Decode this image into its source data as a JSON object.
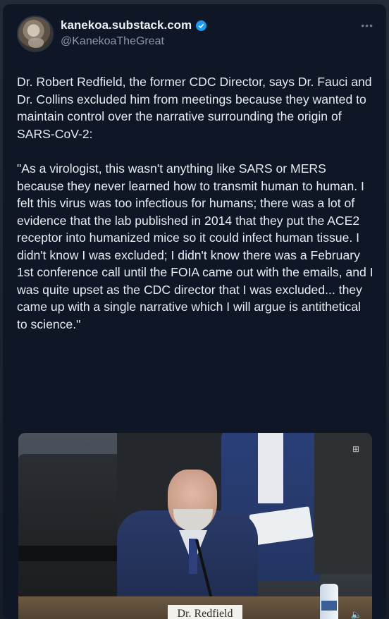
{
  "user": {
    "display_name": "kanekoa.substack.com",
    "handle": "@KanekoaTheGreat"
  },
  "tweet": {
    "paragraphs": [
      "Dr. Robert Redfield, the former CDC Director, says Dr. Fauci and Dr. Collins excluded him from meetings because they wanted to maintain control over the narrative surrounding the origin of SARS-CoV-2:",
      "\"As a virologist, this wasn't anything like SARS or MERS because they never learned how to transmit human to human. I felt this virus was too infectious for humans; there was a lot of evidence that the lab published in 2014 that they put the ACE2 receptor into humanized mice so it could infect human tissue. I didn't know I was excluded; I didn't know there was a February 1st conference call until the FOIA came out with the emails, and I was quite upset as the CDC director that I was excluded... they came up with a single narrative which I will argue is antithetical to science.\""
    ]
  },
  "media": {
    "nameplate": "Dr. Redfield"
  },
  "icons": {
    "verified": "verified-badge-icon",
    "more": "more-options-icon",
    "volume": "volume-icon"
  },
  "colors": {
    "background": "#0f1726",
    "text": "#e7ecf3",
    "handle": "#8b98a9",
    "verified": "#1d9bf0"
  }
}
